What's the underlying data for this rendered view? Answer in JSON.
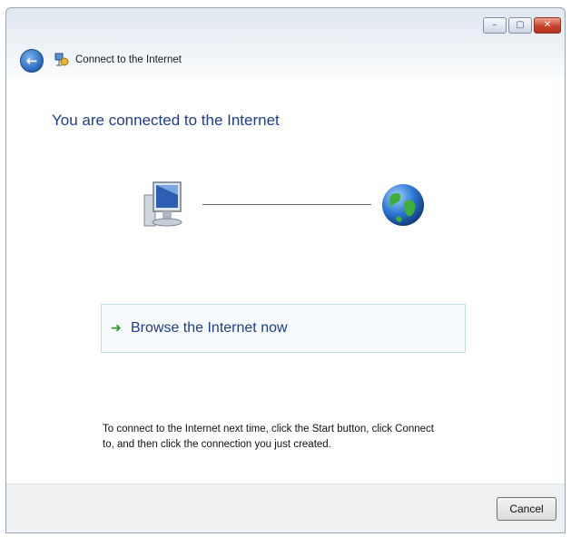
{
  "window": {
    "title": "Connect to the Internet"
  },
  "caption": {
    "minimize": "–",
    "maximize": "▢",
    "close": "✕"
  },
  "content": {
    "heading": "You are connected to the Internet",
    "browse_link": "Browse the Internet now",
    "instructions": "To connect to the Internet next time, click the Start button, click Connect to, and then click the connection you just created."
  },
  "footer": {
    "cancel_label": "Cancel"
  },
  "icons": {
    "back": "back-arrow-icon",
    "network": "network-icon",
    "computer": "computer-icon",
    "globe": "globe-icon",
    "arrow": "green-arrow-icon"
  },
  "colors": {
    "heading": "#1e3d8a",
    "link": "#1e3d8a",
    "arrow": "#2b9a26",
    "close_button": "#c7442a"
  }
}
